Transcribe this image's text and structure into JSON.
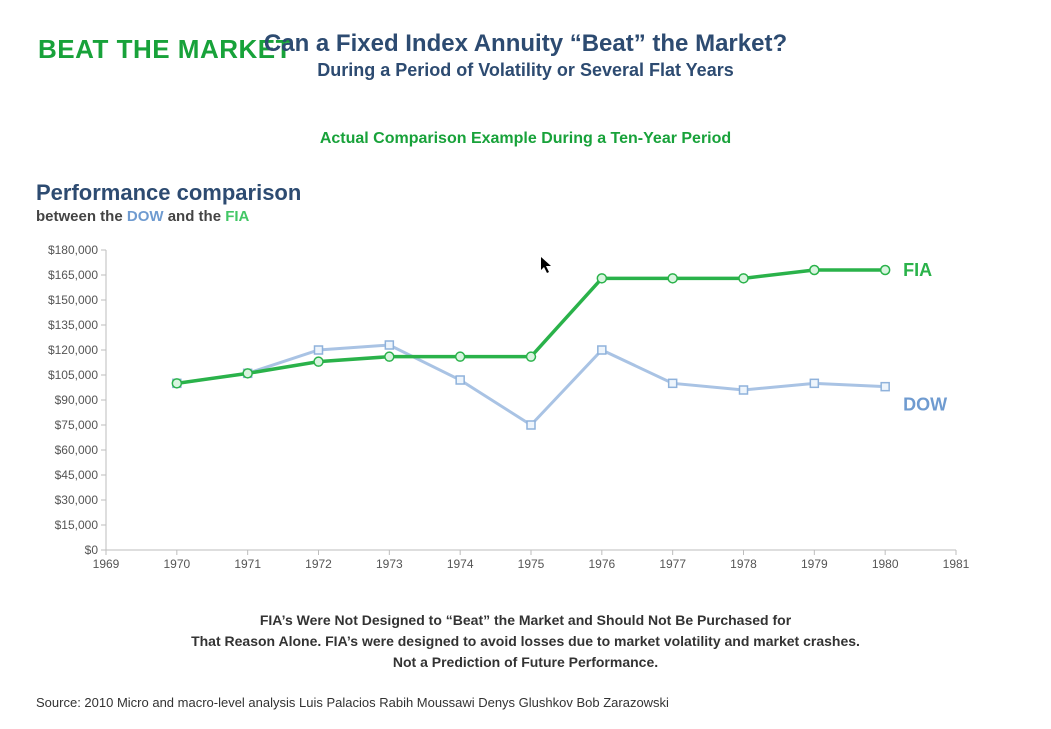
{
  "brand": "BEAT THE MARKET",
  "title": "Can a Fixed Index Annuity “Beat” the Market?",
  "subtitle": "During a Period of Volatility or Several Flat Years",
  "example_caption": "Actual Comparison Example During a Ten-Year Period",
  "perf_title": "Performance comparison",
  "perf_sub_prefix": "between the ",
  "perf_sub_dow": "DOW",
  "perf_sub_middle": " and the ",
  "perf_sub_fia": "FIA",
  "series_label_fia": "FIA",
  "series_label_dow": "DOW",
  "disclaimer_line1": "FIA’s Were Not Designed to “Beat” the Market and Should Not Be Purchased for",
  "disclaimer_line2": "That Reason Alone. FIA’s were designed to avoid losses due to market volatility and market crashes.",
  "disclaimer_line3": "Not a Prediction of Future Performance.",
  "source": "Source: 2010 Micro and macro-level analysis Luis Palacios Rabih Moussawi Denys Glushkov Bob Zarazowski",
  "chart_data": {
    "type": "line",
    "xlabel": "",
    "ylabel": "",
    "ylim": [
      0,
      180000
    ],
    "xlim": [
      1969,
      1981
    ],
    "y_ticks": [
      0,
      15000,
      30000,
      45000,
      60000,
      75000,
      90000,
      105000,
      120000,
      135000,
      150000,
      165000,
      180000
    ],
    "y_tick_labels": [
      "$0",
      "$15,000",
      "$30,000",
      "$45,000",
      "$60,000",
      "$75,000",
      "$90,000",
      "$105,000",
      "$120,000",
      "$135,000",
      "$150,000",
      "$165,000",
      "$180,000"
    ],
    "x_ticks": [
      1969,
      1970,
      1971,
      1972,
      1973,
      1974,
      1975,
      1976,
      1977,
      1978,
      1979,
      1980,
      1981
    ],
    "categories": [
      1970,
      1971,
      1972,
      1973,
      1974,
      1975,
      1976,
      1977,
      1978,
      1979,
      1980
    ],
    "series": [
      {
        "name": "DOW",
        "values": [
          100000,
          106000,
          120000,
          123000,
          102000,
          75000,
          120000,
          100000,
          96000,
          100000,
          98000
        ]
      },
      {
        "name": "FIA",
        "values": [
          100000,
          106000,
          113000,
          116000,
          116000,
          116000,
          163000,
          163000,
          163000,
          168000,
          168000
        ]
      }
    ]
  }
}
